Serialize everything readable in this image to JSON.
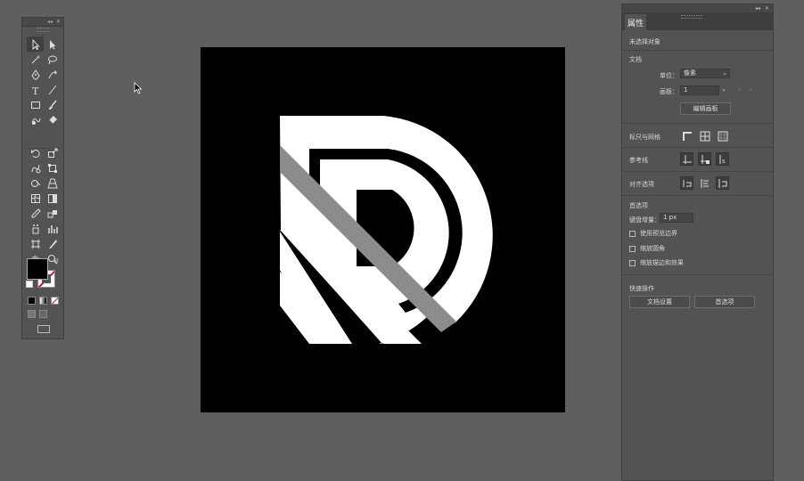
{
  "properties_panel": {
    "tab_label": "属性",
    "no_selection": "未选择对象",
    "document_section": "文档",
    "units_label": "单位：",
    "units_value": "像素",
    "artboard_label": "画板：",
    "artboard_value": "1",
    "edit_artboard_button": "编辑画板",
    "rulers_grids_section": "标尺与网格",
    "guides_section": "参考线",
    "snap_options_section": "对齐选项",
    "preferences_section": "首选项",
    "keyboard_increment_label": "键盘增量：",
    "keyboard_increment_value": "1 px",
    "checkbox_preview_bounds": "使用预览边界",
    "checkbox_scale_corners": "缩放圆角",
    "checkbox_scale_strokes": "缩放描边和效果",
    "quick_actions_section": "快速操作",
    "document_setup_button": "文档设置",
    "preferences_button": "首选项"
  },
  "colors": {
    "workspace": "#5f5f5f",
    "panel": "#535353",
    "artboard": "#000000",
    "logo_white": "#ffffff",
    "logo_gray": "#8c8c8c",
    "fill_swatch": "#000000",
    "stroke_swatch": "#ffffff",
    "none_slash": "#e0121b"
  },
  "toolbar_icons": [
    "selection-icon",
    "direct-selection-icon",
    "magic-wand-icon",
    "lasso-icon",
    "pen-icon",
    "curvature-icon",
    "type-icon",
    "line-icon",
    "rectangle-icon",
    "paintbrush-icon",
    "shaper-icon",
    "eraser-icon",
    "rotate-icon",
    "scale-icon",
    "warp-icon",
    "free-transform-icon",
    "shape-builder-icon",
    "perspective-grid-icon",
    "mesh-icon",
    "gradient-icon",
    "eyedropper-icon",
    "blend-icon",
    "symbol-sprayer-icon",
    "column-graph-icon",
    "artboard-icon",
    "slice-icon",
    "hand-icon",
    "zoom-icon"
  ]
}
